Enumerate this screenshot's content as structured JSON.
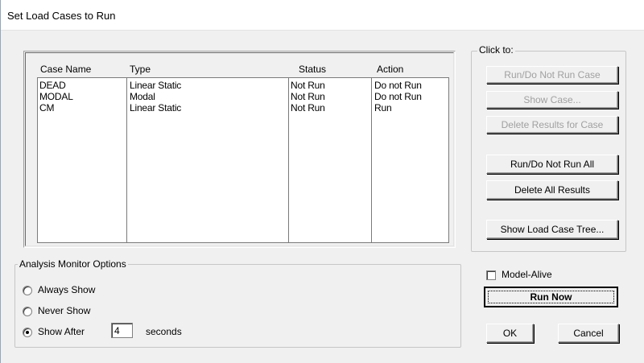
{
  "window": {
    "title": "Set Load Cases to Run"
  },
  "table": {
    "headers": {
      "case_name": "Case Name",
      "type": "Type",
      "status": "Status",
      "action": "Action"
    },
    "rows": [
      {
        "case_name": "DEAD",
        "type": "Linear Static",
        "status": "Not Run",
        "action": "Do not Run"
      },
      {
        "case_name": "MODAL",
        "type": "Modal",
        "status": "Not Run",
        "action": "Do not Run"
      },
      {
        "case_name": "CM",
        "type": "Linear Static",
        "status": "Not Run",
        "action": "Run"
      }
    ]
  },
  "click_to": {
    "label": "Click to:",
    "run_do_not_run_case": "Run/Do Not Run Case",
    "show_case": "Show Case...",
    "delete_results_for_case": "Delete Results for Case",
    "run_do_not_run_all": "Run/Do Not Run All",
    "delete_all_results": "Delete All Results",
    "show_load_case_tree": "Show Load Case Tree..."
  },
  "monitor_options": {
    "label": "Analysis Monitor Options",
    "always_show": "Always Show",
    "never_show": "Never Show",
    "show_after": "Show After",
    "seconds_value": "4",
    "seconds_label": "seconds",
    "selected": "show_after"
  },
  "model_alive": {
    "label": "Model-Alive",
    "checked": false
  },
  "buttons": {
    "run_now": "Run Now",
    "ok": "OK",
    "cancel": "Cancel"
  }
}
